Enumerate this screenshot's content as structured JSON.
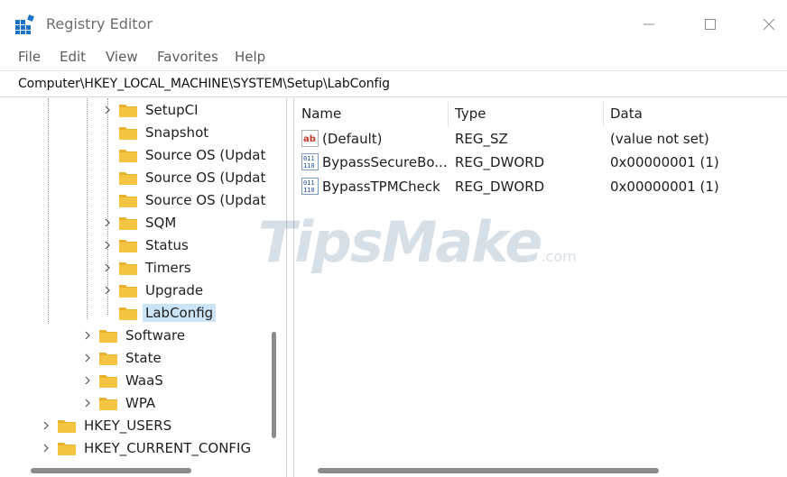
{
  "window": {
    "title": "Registry Editor"
  },
  "menu": [
    "File",
    "Edit",
    "View",
    "Favorites",
    "Help"
  ],
  "address": "Computer\\HKEY_LOCAL_MACHINE\\SYSTEM\\Setup\\LabConfig",
  "tree": [
    {
      "label": "SetupCI",
      "expandable": true
    },
    {
      "label": "Snapshot",
      "expandable": false
    },
    {
      "label": "Source OS (Updat",
      "expandable": false
    },
    {
      "label": "Source OS (Updat",
      "expandable": false
    },
    {
      "label": "Source OS (Updat",
      "expandable": false
    },
    {
      "label": "SQM",
      "expandable": true
    },
    {
      "label": "Status",
      "expandable": true
    },
    {
      "label": "Timers",
      "expandable": true
    },
    {
      "label": "Upgrade",
      "expandable": true
    },
    {
      "label": "LabConfig",
      "expandable": false,
      "selected": true
    },
    {
      "label": "Software",
      "expandable": true
    },
    {
      "label": "State",
      "expandable": true
    },
    {
      "label": "WaaS",
      "expandable": true
    },
    {
      "label": "WPA",
      "expandable": true
    },
    {
      "label": "HKEY_USERS",
      "expandable": true
    },
    {
      "label": "HKEY_CURRENT_CONFIG",
      "expandable": true
    }
  ],
  "values_table": {
    "headers": {
      "name": "Name",
      "type": "Type",
      "data": "Data"
    },
    "rows": [
      {
        "icon": "string-value-icon",
        "name": "(Default)",
        "type": "REG_SZ",
        "data": "(value not set)"
      },
      {
        "icon": "binary-value-icon",
        "name": "BypassSecureBo...",
        "type": "REG_DWORD",
        "data": "0x00000001 (1)"
      },
      {
        "icon": "binary-value-icon",
        "name": "BypassTPMCheck",
        "type": "REG_DWORD",
        "data": "0x00000001 (1)"
      }
    ]
  },
  "watermark": {
    "main": "TipsMake",
    "suffix": ".com"
  },
  "colors": {
    "selection": "#cce4f7",
    "folder": "#f4c542",
    "accent_blue": "#0a63c9"
  }
}
